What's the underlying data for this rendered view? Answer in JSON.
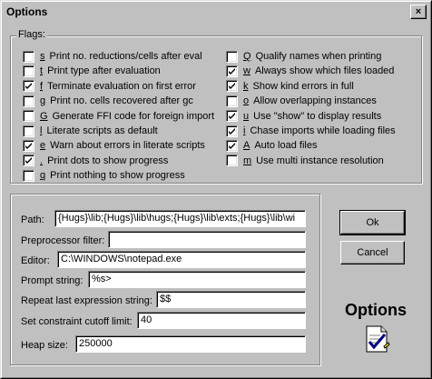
{
  "window": {
    "title": "Options"
  },
  "flags_group": {
    "label": "Flags:"
  },
  "flags": [
    {
      "key": "s",
      "label": "Print no. reductions/cells after eval",
      "checked": false
    },
    {
      "key": "t",
      "label": "Print type after evaluation",
      "checked": false
    },
    {
      "key": "f",
      "label": "Terminate evaluation on first error",
      "checked": true
    },
    {
      "key": "g",
      "label": "Print no. cells recovered after gc",
      "checked": false
    },
    {
      "key": "G",
      "label": "Generate FFI code for foreign import",
      "checked": false
    },
    {
      "key": "l",
      "label": "Literate scripts as default",
      "checked": false
    },
    {
      "key": "e",
      "label": "Warn about errors in literate scripts",
      "checked": true
    },
    {
      "key": ".",
      "label": "Print dots to show progress",
      "checked": true
    },
    {
      "key": "q",
      "label": "Print nothing to show progress",
      "checked": false
    },
    {
      "key": "Q",
      "label": "Qualify names when printing",
      "checked": false
    },
    {
      "key": "w",
      "label": "Always show which files loaded",
      "checked": true
    },
    {
      "key": "k",
      "label": "Show kind errors in full",
      "checked": true
    },
    {
      "key": "o",
      "label": "Allow overlapping instances",
      "checked": false
    },
    {
      "key": "u",
      "label": "Use \"show\" to display results",
      "checked": true
    },
    {
      "key": "i",
      "label": "Chase imports while loading files",
      "checked": true
    },
    {
      "key": "A",
      "label": "Auto load files",
      "checked": true
    },
    {
      "key": "m",
      "label": "Use multi instance resolution",
      "checked": false
    }
  ],
  "fields": {
    "path": {
      "label": "Path:",
      "value": "{Hugs}\\lib;{Hugs}\\lib\\hugs;{Hugs}\\lib\\exts;{Hugs}\\lib\\wi"
    },
    "preprocessor": {
      "label": "Preprocessor filter:",
      "value": ""
    },
    "editor": {
      "label": "Editor:",
      "value": "C:\\WINDOWS\\notepad.exe"
    },
    "prompt": {
      "label": "Prompt string:",
      "value": "%s>"
    },
    "repeat": {
      "label": "Repeat last expression string:",
      "value": "$$"
    },
    "cutoff": {
      "label": "Set constraint cutoff limit:",
      "value": "40"
    },
    "heap": {
      "label": "Heap size:",
      "value": "250000"
    }
  },
  "buttons": {
    "ok": "Ok",
    "cancel": "Cancel",
    "close": "×"
  },
  "logo": {
    "text": "Options",
    "icon": "options-checklist-icon"
  }
}
